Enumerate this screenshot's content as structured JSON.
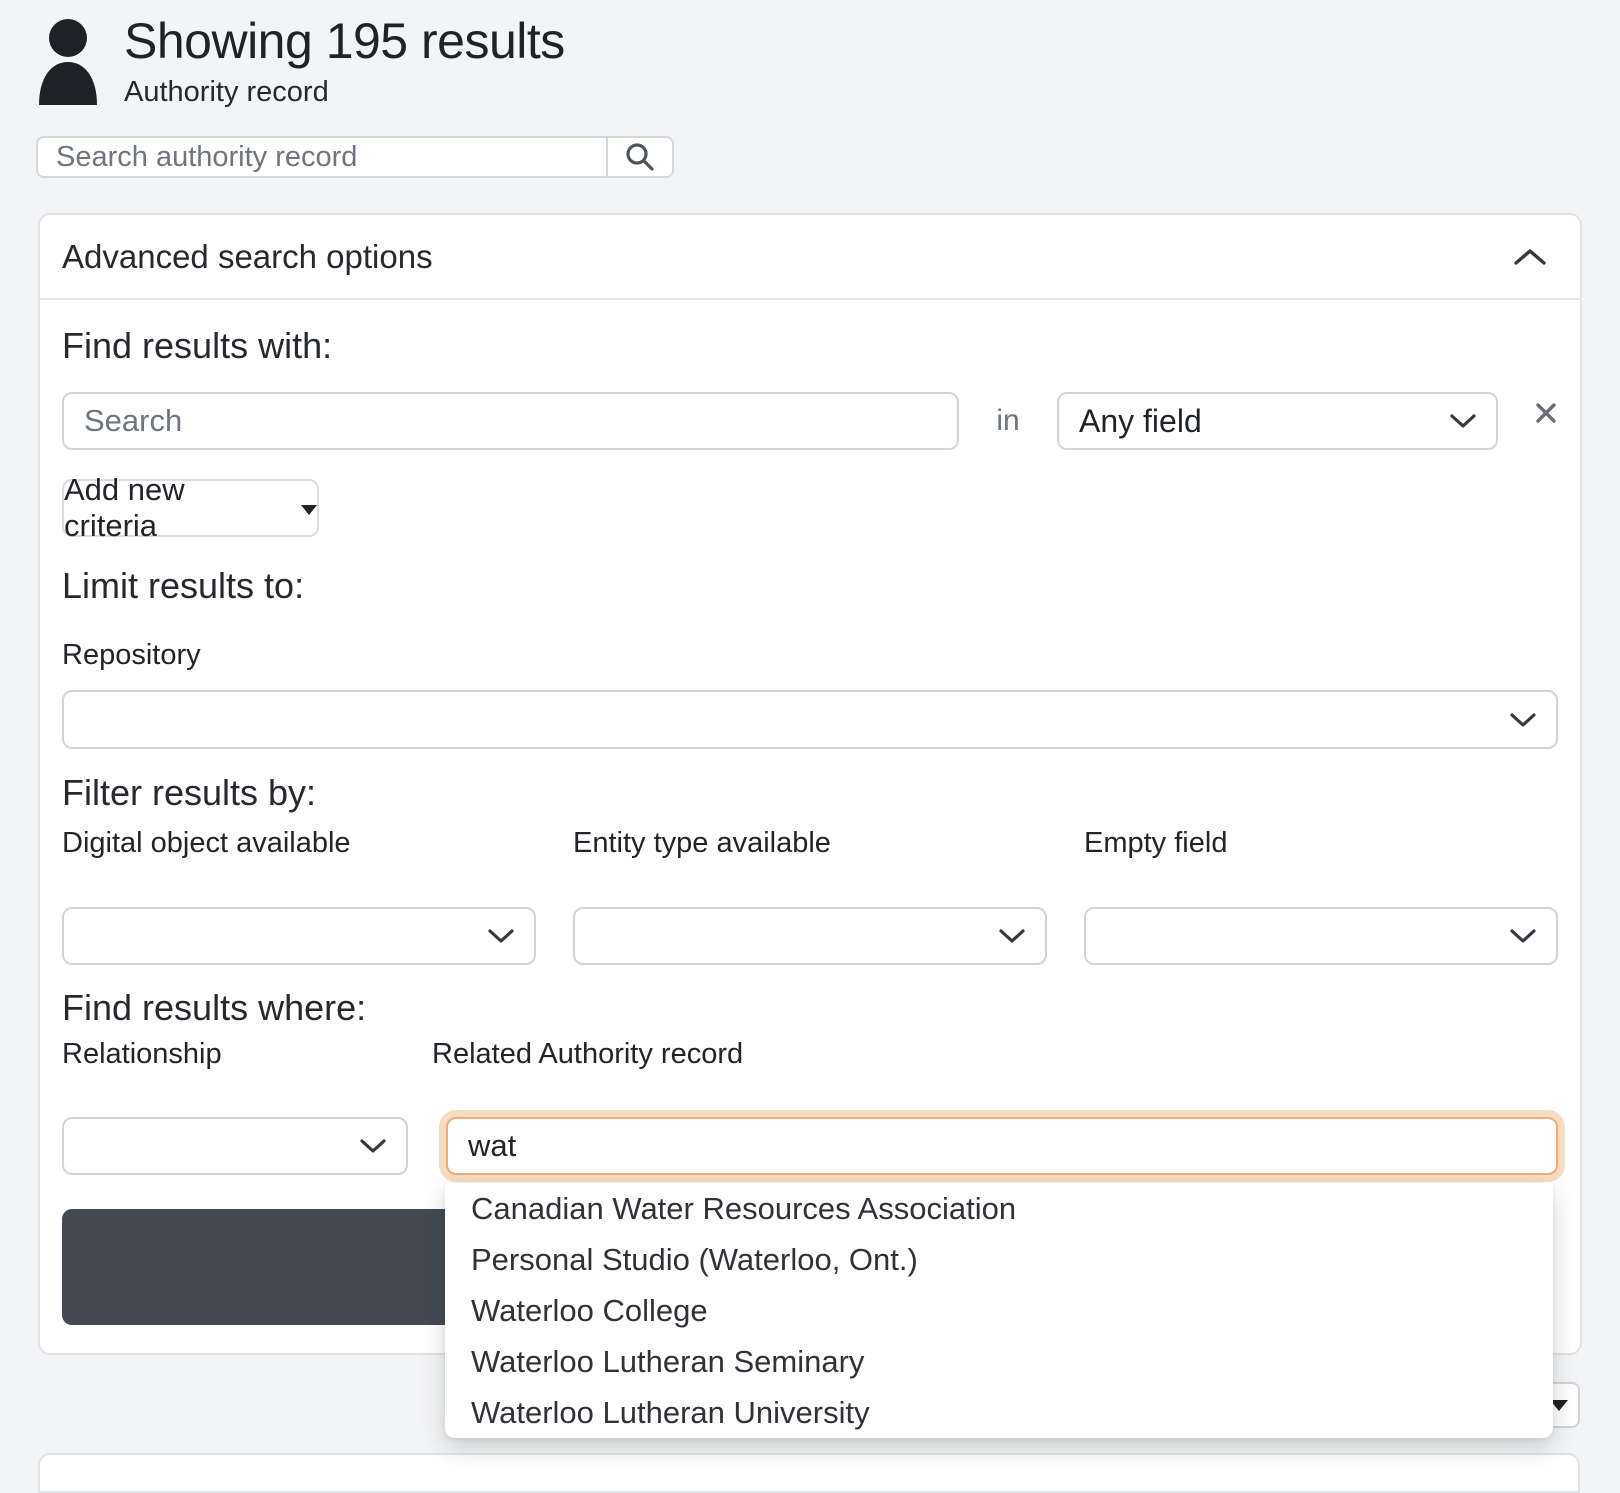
{
  "header": {
    "title": "Showing 195 results",
    "subtitle": "Authority record"
  },
  "search_bar": {
    "placeholder": "Search authority record",
    "icon": "search-icon"
  },
  "advanced_panel": {
    "title": "Advanced search options",
    "collapse_icon": "chevron-up-icon",
    "find_results_with": {
      "heading": "Find results with:",
      "search_placeholder": "Search",
      "in_label": "in",
      "field_select_value": "Any field",
      "remove_icon": "x-icon"
    },
    "add_criteria_label": "Add new criteria",
    "limit_results": {
      "heading": "Limit results to:",
      "repository_label": "Repository",
      "repository_value": ""
    },
    "filter_results": {
      "heading": "Filter results by:",
      "filters": [
        {
          "label": "Digital object available",
          "value": ""
        },
        {
          "label": "Entity type available",
          "value": ""
        },
        {
          "label": "Empty field",
          "value": ""
        }
      ]
    },
    "find_results_where": {
      "heading": "Find results where:",
      "relationship_label": "Relationship",
      "relationship_value": "",
      "related_label": "Related Authority record",
      "related_value": "wat"
    }
  },
  "autocomplete": {
    "items": [
      "Canadian Water Resources Association",
      "Personal Studio (Waterloo, Ont.)",
      "Waterloo College",
      "Waterloo Lutheran Seminary",
      "Waterloo Lutheran University"
    ]
  },
  "colors": {
    "page_background": "#f3f4f6",
    "card_background": "#ffffff",
    "border": "#ced4da",
    "text": "#212529",
    "muted_text": "#6c757d",
    "dark_button": "#434a54",
    "focus_ring": "#f8dcc2",
    "focus_border": "#efab7c"
  }
}
